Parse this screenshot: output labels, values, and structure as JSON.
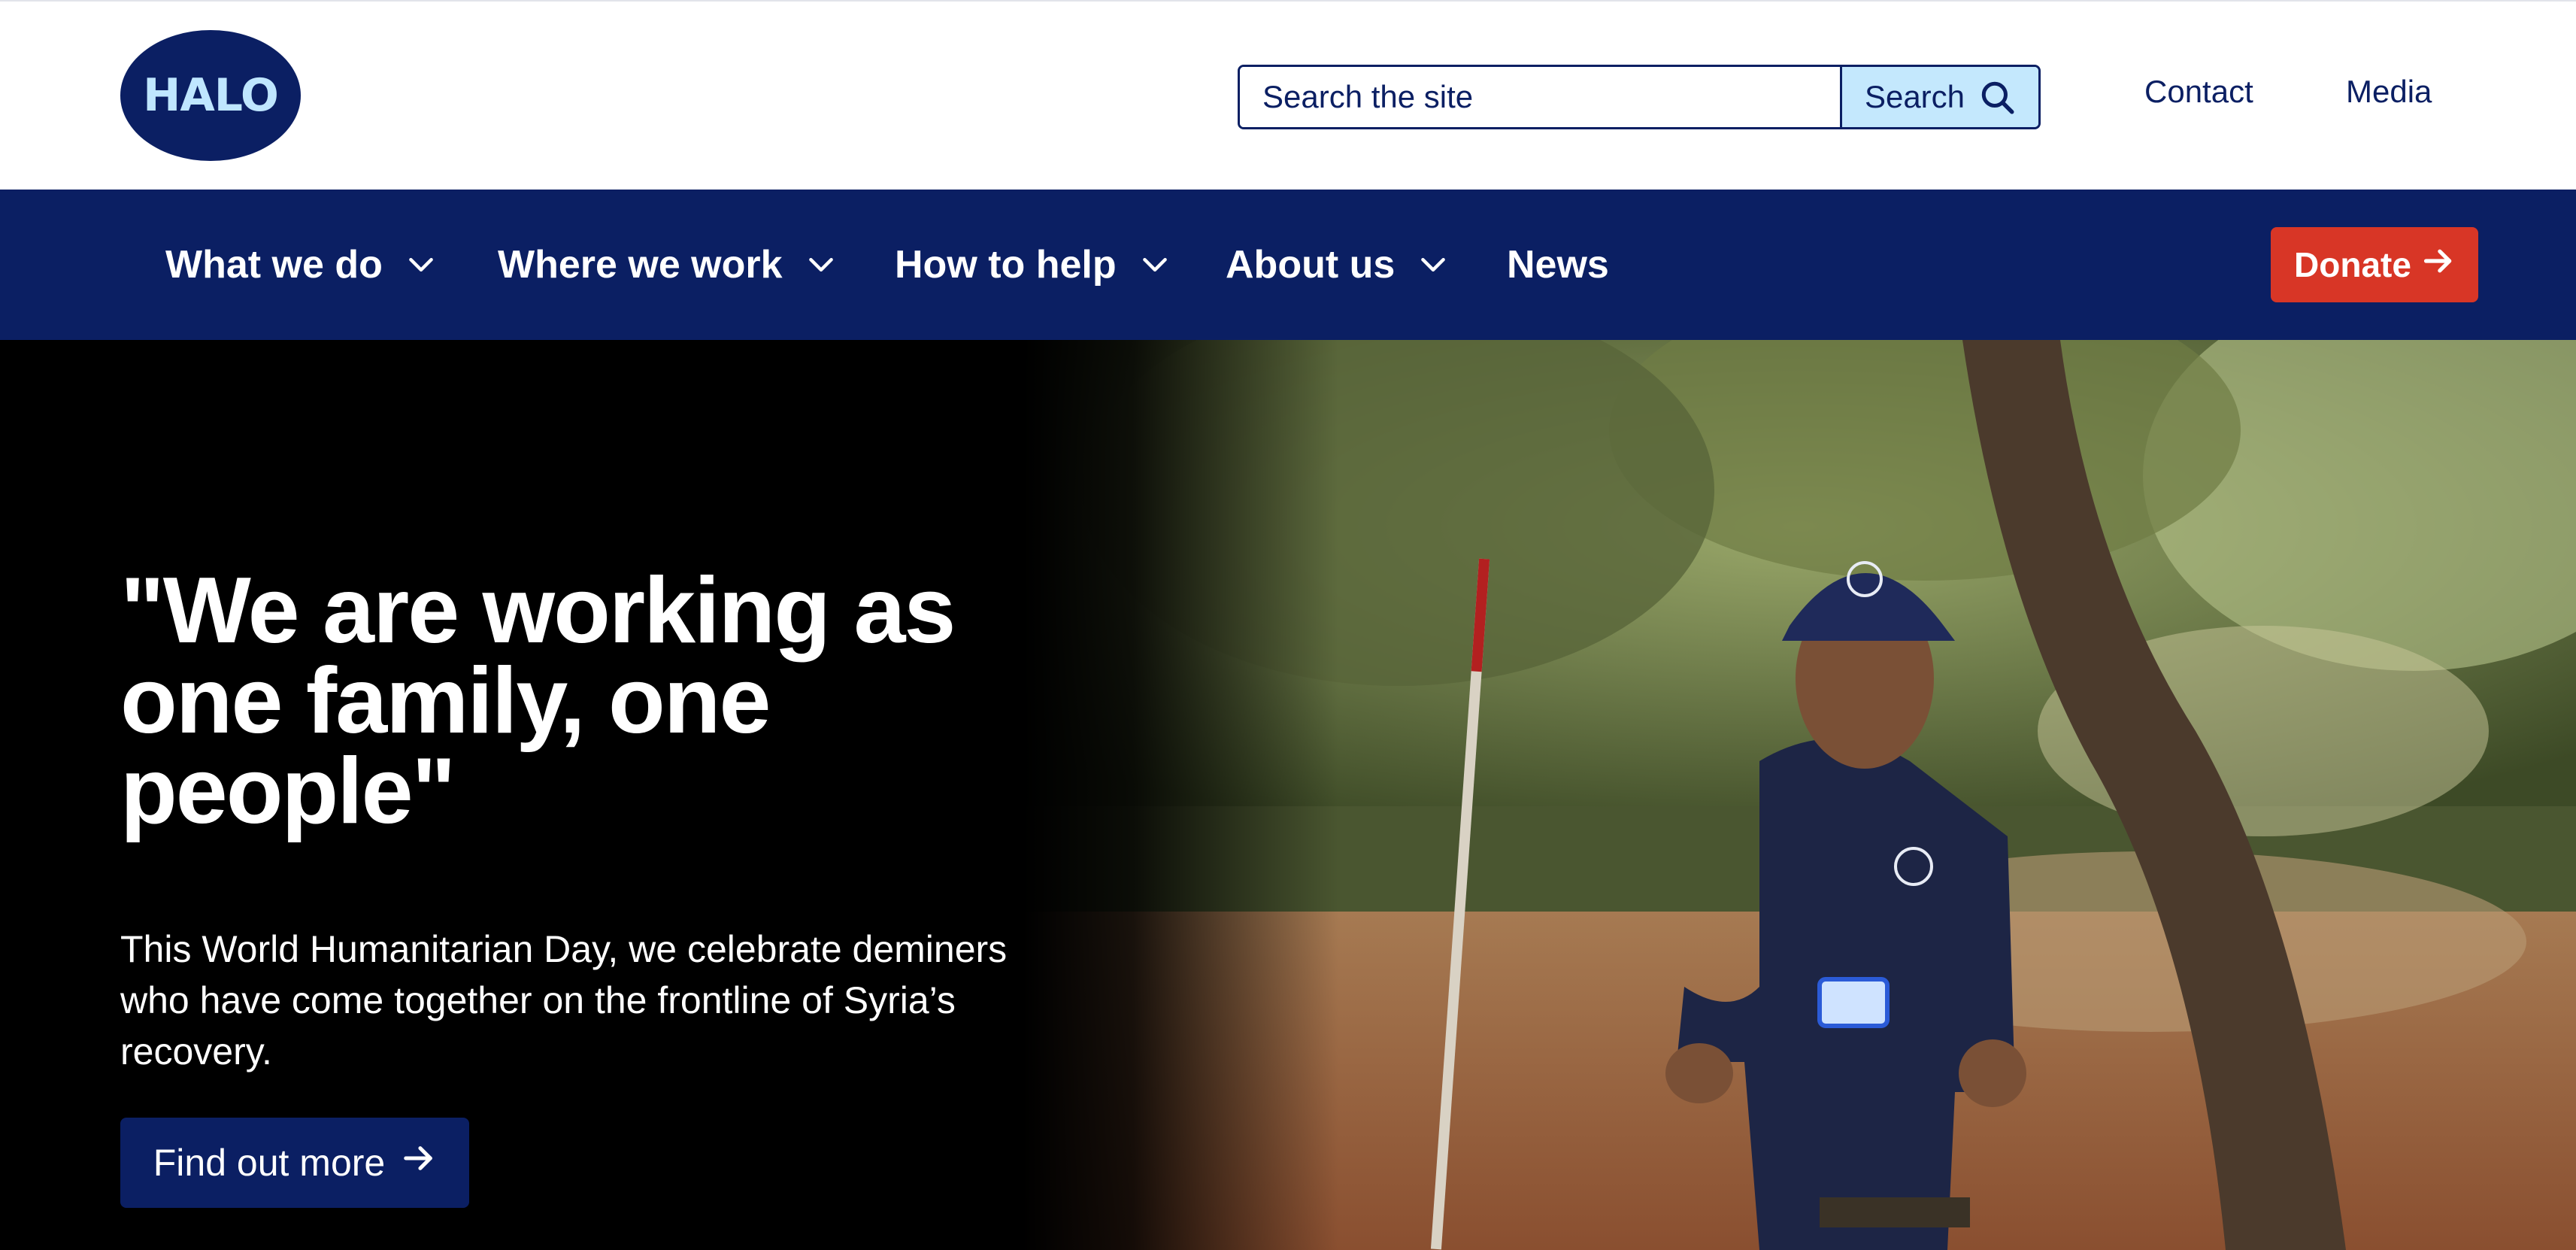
{
  "header": {
    "logo_text": "HALO",
    "search": {
      "placeholder": "Search the site",
      "button_label": "Search"
    },
    "utility_links": [
      "Contact",
      "Media"
    ]
  },
  "nav": {
    "items": [
      {
        "label": "What we do",
        "has_dropdown": true
      },
      {
        "label": "Where we work",
        "has_dropdown": true
      },
      {
        "label": "How to help",
        "has_dropdown": true
      },
      {
        "label": "About us",
        "has_dropdown": true
      },
      {
        "label": "News",
        "has_dropdown": false
      }
    ],
    "donate_label": "Donate"
  },
  "hero": {
    "heading": "\"We are working as one family, one people\"",
    "body": "This World Humanitarian Day, we celebrate deminers who have come together on the frontline of Syria’s recovery.",
    "cta_label": "Find out more",
    "image_subject": "deminer-thumbs-up-under-olive-trees"
  },
  "colors": {
    "brand_navy": "#0b1f63",
    "light_blue": "#c4e8fd",
    "donate_red": "#d83626",
    "hero_background": "#000000"
  },
  "icons": {
    "search": "search-icon",
    "dropdown": "chevron-down-icon",
    "arrow": "arrow-right-icon"
  }
}
